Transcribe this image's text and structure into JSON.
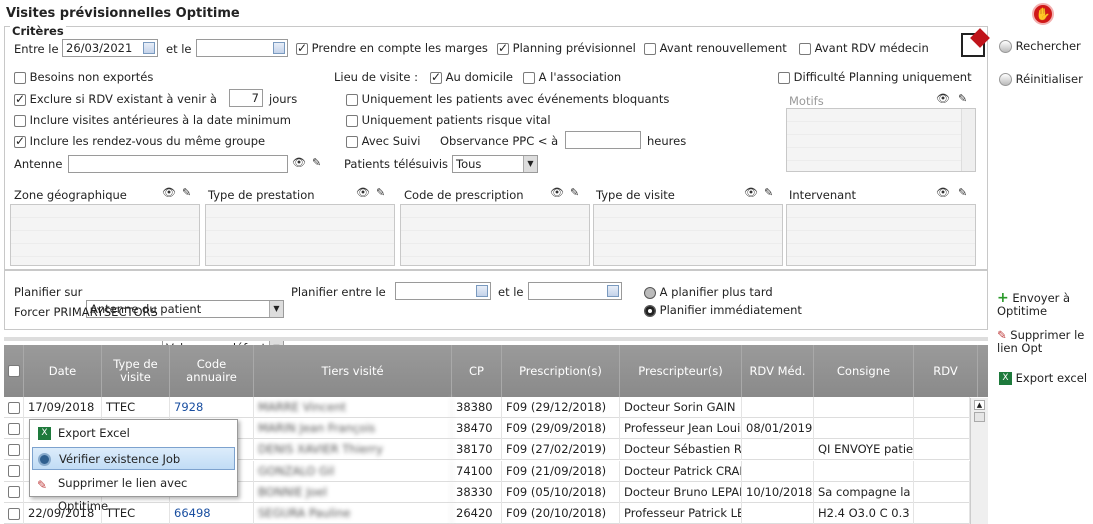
{
  "title": "Visites prévisionnelles Optitime",
  "criteria": {
    "legend": "Critères",
    "entre_le": "Entre le",
    "date_from": "26/03/2021",
    "et_le": "et le",
    "date_to": "",
    "marges": "Prendre en compte les marges",
    "planning_prev": "Planning prévisionnel",
    "avant_renouv": "Avant renouvellement",
    "avant_rdv": "Avant RDV médecin",
    "besoins": "Besoins non exportés",
    "exclure": "Exclure si RDV existant à venir à",
    "exclure_days": "7",
    "jours": "jours",
    "inclure_ant": "Inclure visites antérieures à la date minimum",
    "inclure_rdv": "Inclure les rendez-vous du même groupe",
    "antenne": "Antenne",
    "lieu": "Lieu de visite :",
    "domicile": "Au domicile",
    "association": "A l'association",
    "bloquants": "Uniquement les patients avec événements bloquants",
    "risque": "Uniquement patients risque vital",
    "avec_suivi": "Avec Suivi",
    "observance": "Observance PPC < à",
    "heures": "heures",
    "telesuivis": "Patients télésuivis",
    "telesuivis_value": "Tous",
    "difficulte": "Difficulté Planning uniquement",
    "motifs": "Motifs",
    "zone": "Zone géographique",
    "type_prestation": "Type de prestation",
    "code_prescription": "Code de prescription",
    "type_visite": "Type de visite",
    "intervenant": "Intervenant"
  },
  "planning": {
    "planifier_sur": "Planifier sur",
    "planifier_sur_value": "Antenne du patient",
    "planifier_entre": "Planifier entre le",
    "et_le": "et le",
    "forcer": "Forcer PRIMARYSECTORS",
    "forcer_value": "Valeur par défaut",
    "plus_tard": "A planifier plus tard",
    "immediat": "Planifier immédiatement"
  },
  "right": {
    "rechercher": "Rechercher",
    "reinitialiser": "Réinitialiser",
    "envoyer": "Envoyer à Optitime",
    "supprimer": "Supprimer le lien Opt",
    "export": "Export excel"
  },
  "grid": {
    "headers": [
      "Date",
      "Type de visite",
      "Code annuaire",
      "Tiers visité",
      "CP",
      "Prescription(s)",
      "Prescripteur(s)",
      "RDV Méd.",
      "Consigne",
      "RDV"
    ],
    "rows": [
      {
        "date": "17/09/2018",
        "type": "TTEC",
        "code": "7928",
        "tiers": "MARRE Vincent",
        "cp": "38380",
        "presc": "F09 (29/12/2018)",
        "prescripteur": "Docteur Sorin GAIN",
        "rdv": "",
        "consigne": ""
      },
      {
        "date": "",
        "type": "",
        "code": "",
        "tiers": "MARIN Jean François",
        "cp": "38470",
        "presc": "F09 (29/09/2018)",
        "prescripteur": "Professeur Jean Louis",
        "rdv": "08/01/2019",
        "consigne": ""
      },
      {
        "date": "",
        "type": "",
        "code": "",
        "tiers": "DENIS XAVIER Thierry",
        "cp": "38170",
        "presc": "F09 (27/02/2019)",
        "prescripteur": "Docteur Sébastien RIE",
        "rdv": "",
        "consigne": "QI ENVOYE patie"
      },
      {
        "date": "",
        "type": "",
        "code": "",
        "tiers": "GONZALO Gil",
        "cp": "74100",
        "presc": "F09 (21/09/2018)",
        "prescripteur": "Docteur Patrick CRAP",
        "rdv": "",
        "consigne": ""
      },
      {
        "date": "",
        "type": "",
        "code": "",
        "tiers": "BONNIE Joel",
        "cp": "38330",
        "presc": "F09 (05/10/2018)",
        "prescripteur": "Docteur Bruno LEPAL",
        "rdv": "10/10/2018",
        "consigne": "Sa compagne la"
      },
      {
        "date": "22/09/2018",
        "type": "TTEC",
        "code": "66498",
        "tiers": "SEGURA Pauline",
        "cp": "26420",
        "presc": "F09 (20/10/2018)",
        "prescripteur": "Professeur Patrick LEV",
        "rdv": "",
        "consigne": "H2.4 O3.0 C 0.3"
      }
    ]
  },
  "context_menu": {
    "items": [
      "Export Excel",
      "Vérifier existence Job",
      "Supprimer le lien avec Optitime"
    ]
  }
}
